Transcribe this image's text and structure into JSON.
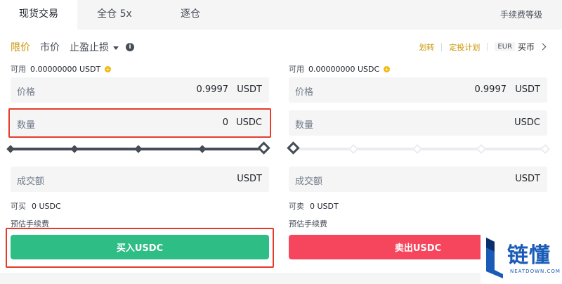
{
  "tabs": [
    {
      "label": "现货交易",
      "active": true
    },
    {
      "label": "全仓 5x",
      "active": false
    },
    {
      "label": "逐仓",
      "active": false
    }
  ],
  "fee_link": "手续费等级",
  "order_types": {
    "limit": "限价",
    "market": "市价",
    "stop": "止盈止损"
  },
  "right_links": {
    "transfer": "划转",
    "recurring": "定投计划",
    "currency": "EUR",
    "buy_coin": "买币"
  },
  "buy": {
    "available_label": "可用",
    "available_value": "0.00000000 USDT",
    "price_label": "价格",
    "price_value": "0.9997",
    "price_unit": "USDT",
    "amount_label": "数量",
    "amount_value": "0",
    "amount_unit": "USDC",
    "slider_percent": 100,
    "total_label": "成交额",
    "total_unit": "USDT",
    "max_label": "可买",
    "max_value": "0 USDC",
    "fee_label": "预估手续费",
    "button_label": "买入USDC"
  },
  "sell": {
    "available_label": "可用",
    "available_value": "0.00000000 USDC",
    "price_label": "价格",
    "price_value": "0.9997",
    "price_unit": "USDT",
    "amount_label": "数量",
    "amount_value": "",
    "amount_unit": "USDC",
    "slider_percent": 0,
    "total_label": "成交额",
    "total_unit": "USDT",
    "max_label": "可卖",
    "max_value": "0 USDT",
    "fee_label": "预估手续费",
    "button_label": "卖出USDC"
  },
  "watermark": {
    "text": "链懂",
    "sub": "NEATDOWN.COM"
  },
  "colors": {
    "accent": "#c99400",
    "buy": "#2ebd85",
    "sell": "#f6465d",
    "highlight": "#e63a2a"
  }
}
